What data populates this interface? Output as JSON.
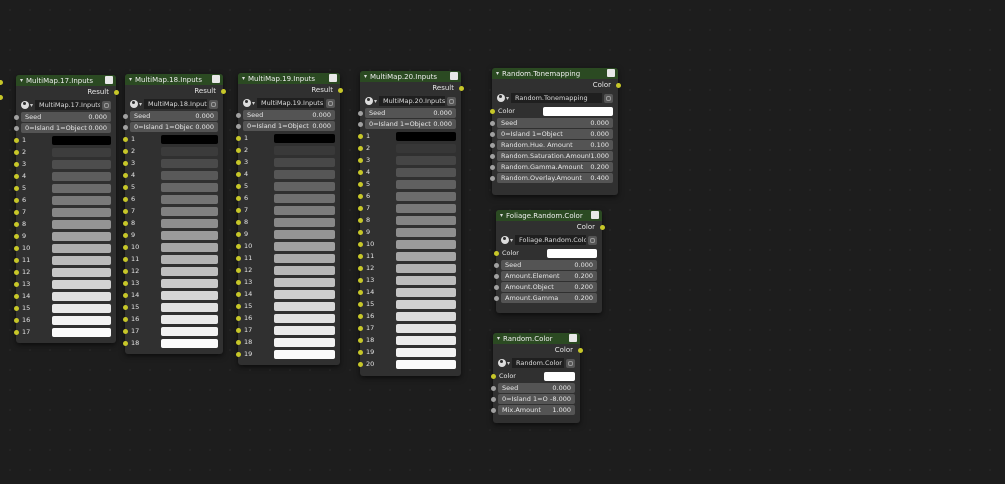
{
  "multimap_nodes": [
    {
      "title": "MultiMap.17.Inputs",
      "result": "Result",
      "selector": "MultiMap.17.Inputs",
      "seed": {
        "label": "Seed",
        "value": "0.000"
      },
      "island": {
        "label": "0=Island 1=Object",
        "value": "0.000"
      },
      "ramp_labels": [
        "1",
        "2",
        "3",
        "4",
        "5",
        "6",
        "7",
        "8",
        "9",
        "10",
        "11",
        "12",
        "13",
        "14",
        "15",
        "16",
        "17"
      ],
      "ramp_colors": [
        "#000000",
        "#3d3d3d",
        "#4d4d4d",
        "#5d5d5d",
        "#6c6c6c",
        "#7a7a7a",
        "#878787",
        "#949494",
        "#a1a1a1",
        "#aeaeae",
        "#bbbbbb",
        "#c7c7c7",
        "#d3d3d3",
        "#dfdfdf",
        "#e9e9e9",
        "#f3f3f3",
        "#fbfbfb"
      ]
    },
    {
      "title": "MultiMap.18.Inputs",
      "result": "Result",
      "selector": "MultiMap.18.Inputs",
      "seed": {
        "label": "Seed",
        "value": "0.000"
      },
      "island": {
        "label": "0=Island 1=Objec",
        "value": "0.000"
      },
      "ramp_labels": [
        "1",
        "2",
        "3",
        "4",
        "5",
        "6",
        "7",
        "8",
        "9",
        "10",
        "11",
        "12",
        "13",
        "14",
        "15",
        "16",
        "17",
        "18"
      ],
      "ramp_colors": [
        "#000000",
        "#3b3b3b",
        "#4a4a4a",
        "#595959",
        "#676767",
        "#747474",
        "#818181",
        "#8e8e8e",
        "#9b9b9b",
        "#a7a7a7",
        "#b3b3b3",
        "#bfbfbf",
        "#cbcbcb",
        "#d6d6d6",
        "#e0e0e0",
        "#eaeaea",
        "#f3f3f3",
        "#fbfbfb"
      ]
    },
    {
      "title": "MultiMap.19.Inputs",
      "result": "Result",
      "selector": "MultiMap.19.Inputs",
      "seed": {
        "label": "Seed",
        "value": "0.000"
      },
      "island": {
        "label": "0=Island 1=Object",
        "value": "0.000"
      },
      "ramp_labels": [
        "1",
        "2",
        "3",
        "4",
        "5",
        "6",
        "7",
        "8",
        "9",
        "10",
        "11",
        "12",
        "13",
        "14",
        "15",
        "16",
        "17",
        "18",
        "19"
      ],
      "ramp_colors": [
        "#000000",
        "#393939",
        "#484848",
        "#565656",
        "#636363",
        "#707070",
        "#7c7c7c",
        "#888888",
        "#949494",
        "#a0a0a0",
        "#ababab",
        "#b7b7b7",
        "#c2c2c2",
        "#cdcdcd",
        "#d7d7d7",
        "#e1e1e1",
        "#eaeaea",
        "#f3f3f3",
        "#fbfbfb"
      ]
    },
    {
      "title": "MultiMap.20.Inputs",
      "result": "Result",
      "selector": "MultiMap.20.Inputs",
      "seed": {
        "label": "Seed",
        "value": "0.000"
      },
      "island": {
        "label": "0=Island 1=Object",
        "value": "0.000"
      },
      "ramp_labels": [
        "1",
        "2",
        "3",
        "4",
        "5",
        "6",
        "7",
        "8",
        "9",
        "10",
        "11",
        "12",
        "13",
        "14",
        "15",
        "16",
        "17",
        "18",
        "19",
        "20"
      ],
      "ramp_colors": [
        "#000000",
        "#373737",
        "#454545",
        "#535353",
        "#606060",
        "#6c6c6c",
        "#787878",
        "#848484",
        "#8f8f8f",
        "#9b9b9b",
        "#a6a6a6",
        "#b1b1b1",
        "#bcbcbc",
        "#c6c6c6",
        "#d0d0d0",
        "#dadada",
        "#e3e3e3",
        "#ebebeb",
        "#f3f3f3",
        "#fbfbfb"
      ]
    }
  ],
  "tonemapping": {
    "title": "Random.Tonemapping",
    "output": "Color",
    "selector": "Random.Tonemapping",
    "color_label": "Color",
    "fields": [
      {
        "label": "Seed",
        "value": "0.000"
      },
      {
        "label": "0=Island 1=Object",
        "value": "0.000"
      },
      {
        "label": "Random.Hue. Amount",
        "value": "0.100"
      },
      {
        "label": "Random.Saturation.Amount",
        "value": "1.000"
      },
      {
        "label": "Random.Gamma.Amount",
        "value": "0.200"
      },
      {
        "label": "Random.Overlay.Amount",
        "value": "0.400"
      }
    ]
  },
  "foliage": {
    "title": "Foliage.Random.Color",
    "output": "Color",
    "selector": "Foliage.Random.Color",
    "color_label": "Color",
    "fields": [
      {
        "label": "Seed",
        "value": "0.000"
      },
      {
        "label": "Amount.Element",
        "value": "0.200"
      },
      {
        "label": "Amount.Object",
        "value": "0.200"
      },
      {
        "label": "Amount.Gamma",
        "value": "0.200"
      }
    ]
  },
  "random_color": {
    "title": "Random.Color",
    "output": "Color",
    "selector": "Random.Color",
    "color_label": "Color",
    "fields": [
      {
        "label": "Seed",
        "value": "0.000"
      },
      {
        "label": "0=Island 1=O",
        "value": "-8.000"
      },
      {
        "label": "Mix.Amount",
        "value": "1.000"
      }
    ]
  },
  "colors": {
    "background": "#1d1d1d",
    "node_body": "#303030",
    "node_header": "#2b4a22",
    "socket_color": "#c7c729",
    "socket_float": "#a1a1a1",
    "field_bg": "#545454"
  }
}
